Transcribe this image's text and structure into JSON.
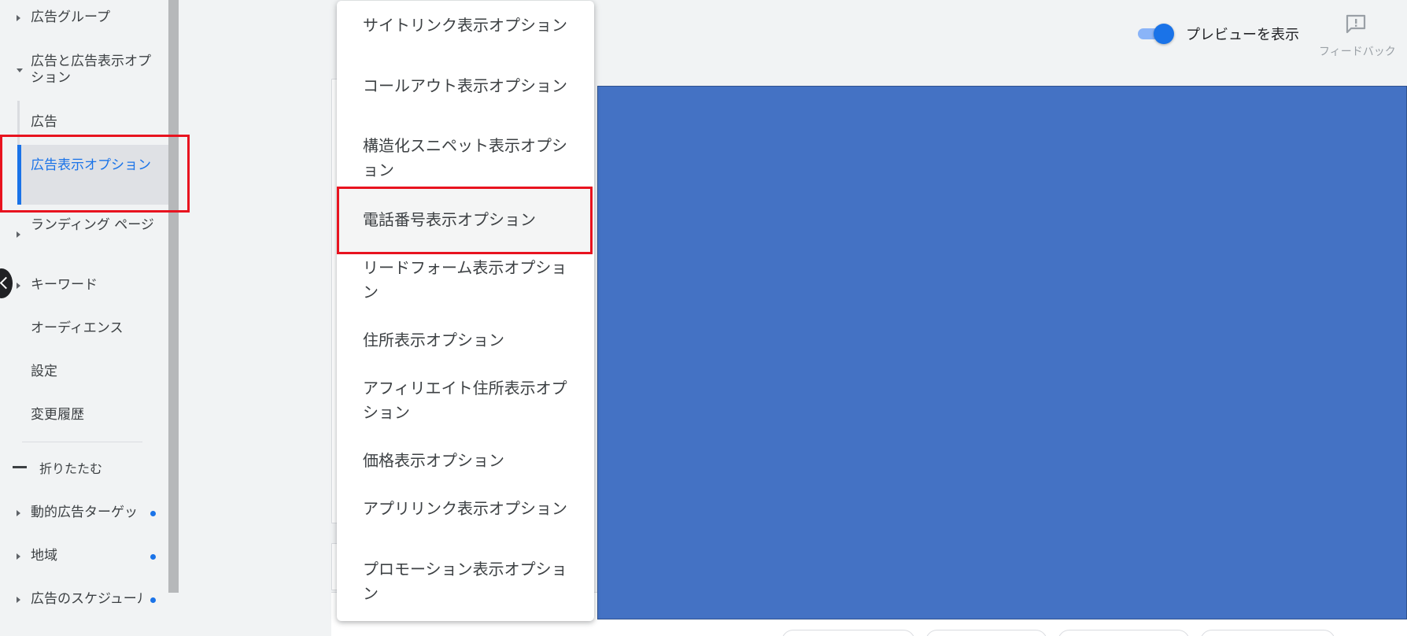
{
  "sidebar": {
    "items": [
      {
        "label": "広告グループ"
      },
      {
        "label": "広告と広告表示オプション"
      },
      {
        "label": "広告"
      },
      {
        "label": "広告表示オプション"
      },
      {
        "label": "ランディング ページ"
      },
      {
        "label": "キーワード"
      },
      {
        "label": "オーディエンス"
      },
      {
        "label": "設定"
      },
      {
        "label": "変更履歴"
      }
    ],
    "collapse_label": "折りたたむ",
    "more_items": [
      {
        "label": "動的広告ターゲット"
      },
      {
        "label": "地域"
      },
      {
        "label": "広告のスケジュール"
      }
    ]
  },
  "header": {
    "preview_toggle_label": "プレビューを表示",
    "preview_toggle_on": true,
    "feedback_label": "フィードバック",
    "feedback_icon": "feedback-icon"
  },
  "menu": {
    "items": [
      {
        "label": "サイトリンク表示オプション"
      },
      {
        "label": "コールアウト表示オプション"
      },
      {
        "label": "構造化スニペット表示オプション"
      },
      {
        "label": "電話番号表示オプション"
      },
      {
        "label": "リードフォーム表示オプション"
      },
      {
        "label": "住所表示オプション"
      },
      {
        "label": "アフィリエイト住所表示オプション"
      },
      {
        "label": "価格表示オプション"
      },
      {
        "label": "アプリリンク表示オプション"
      },
      {
        "label": "プロモーション表示オプション"
      }
    ],
    "highlighted": "電話番号表示オプション"
  },
  "colors": {
    "accent": "#1a73e8",
    "highlight_box": "#e8131f",
    "overlay_panel": "#4472c4"
  }
}
